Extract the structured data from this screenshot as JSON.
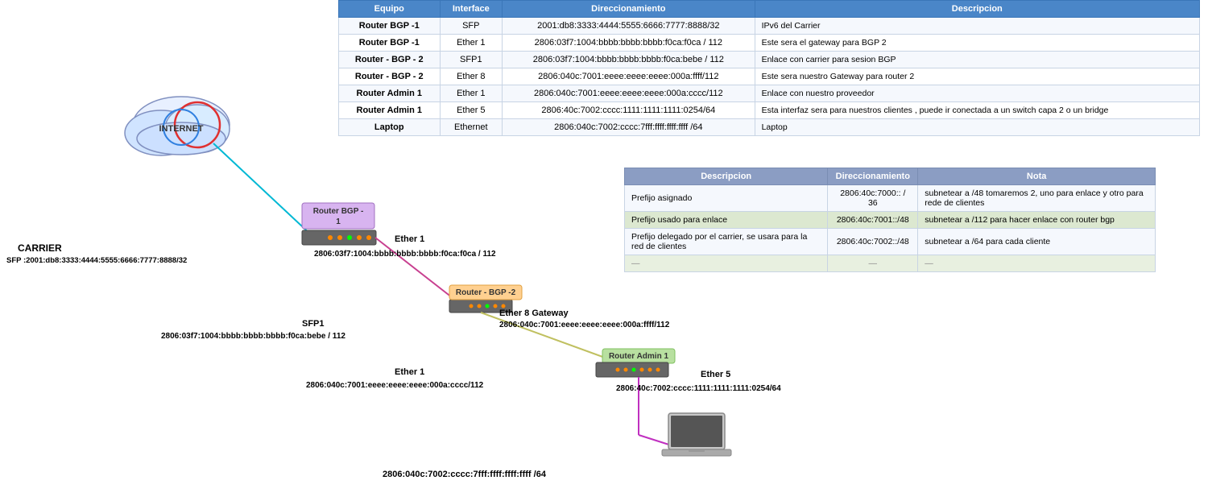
{
  "table": {
    "headers": [
      "Equipo",
      "Interface",
      "Direccionamiento",
      "Descripcion"
    ],
    "rows": [
      [
        "Router BGP -1",
        "SFP",
        "2001:db8:3333:4444:5555:6666:7777:8888/32",
        "IPv6 del Carrier"
      ],
      [
        "Router BGP -1",
        "Ether 1",
        "2806:03f7:1004:bbbb:bbbb:bbbb:f0ca:f0ca / 112",
        "Este sera el gateway para BGP 2"
      ],
      [
        "Router - BGP - 2",
        "SFP1",
        "2806:03f7:1004:bbbb:bbbb:bbbb:f0ca:bebe / 112",
        "Enlace con carrier para sesion BGP"
      ],
      [
        "Router - BGP - 2",
        "Ether 8",
        "2806:040c:7001:eeee:eeee:eeee:000a:ffff/112",
        "Este sera nuestro Gateway para router 2"
      ],
      [
        "Router Admin 1",
        "Ether 1",
        "2806:040c:7001:eeee:eeee:eeee:000a:cccc/112",
        "Enlace con nuestro proveedor"
      ],
      [
        "Router Admin 1",
        "Ether 5",
        "2806:40c:7002:cccc:1111:1111:1111:0254/64",
        "Esta interfaz sera para nuestros clientes , puede ir conectada a un switch capa 2 o un bridge"
      ],
      [
        "Laptop",
        "Ethernet",
        "2806:040c:7002:cccc:7fff:ffff:ffff:ffff /64",
        "Laptop"
      ]
    ]
  },
  "second_table": {
    "headers": [
      "Descripcion",
      "Direccionamiento",
      "Nota"
    ],
    "rows": [
      [
        "Prefijo asignado",
        "2806:40c:7000:: / 36",
        "subnetear a /48  tomaremos 2, uno para enlace y otro para rede de clientes"
      ],
      [
        "Prefijo usado para enlace",
        "2806:40c:7001::/48",
        "subnetear a /112 para hacer enlace con router bgp"
      ],
      [
        "Prefijo delegado por el carrier, se usara para la red de clientes",
        "2806:40c:7002::/48",
        "subnetear a /64 para cada cliente"
      ],
      [
        "—",
        "—",
        "—"
      ]
    ]
  },
  "diagram": {
    "internet_label": "INTERNET",
    "carrier_label": "CARRIER",
    "carrier_sfp": "SFP :2001:db8:3333:4444:5555:6666:7777:8888/32",
    "router_bgp1_label": "Router BGP -\n1",
    "router_bgp2_label": "Router - BGP -2",
    "router_admin1_label": "Router Admin 1",
    "ether1_label1": "Ether 1",
    "ether1_addr1": "2806:03f7:1004:bbbb:bbbb:bbbb:f0ca:f0ca / 112",
    "sfp1_label": "SFP1",
    "sfp1_addr": "2806:03f7:1004:bbbb:bbbb:bbbb:f0ca:bebe / 112",
    "ether8_label": "Ether 8 Gateway",
    "ether8_addr": "2806:040c:7001:eeee:eeee:eeee:000a:ffff/112",
    "ether1_label2": "Ether 1",
    "ether1_addr2": "2806:040c:7001:eeee:eeee:eeee:000a:cccc/112",
    "ether5_label": "Ether 5",
    "ether5_addr": "2806:40c:7002:cccc:1111:1111:1111:0254/64",
    "laptop_addr": "2806:040c:7002:cccc:7fff:ffff:ffff:ffff /64",
    "laptop_label": "Laptop"
  }
}
